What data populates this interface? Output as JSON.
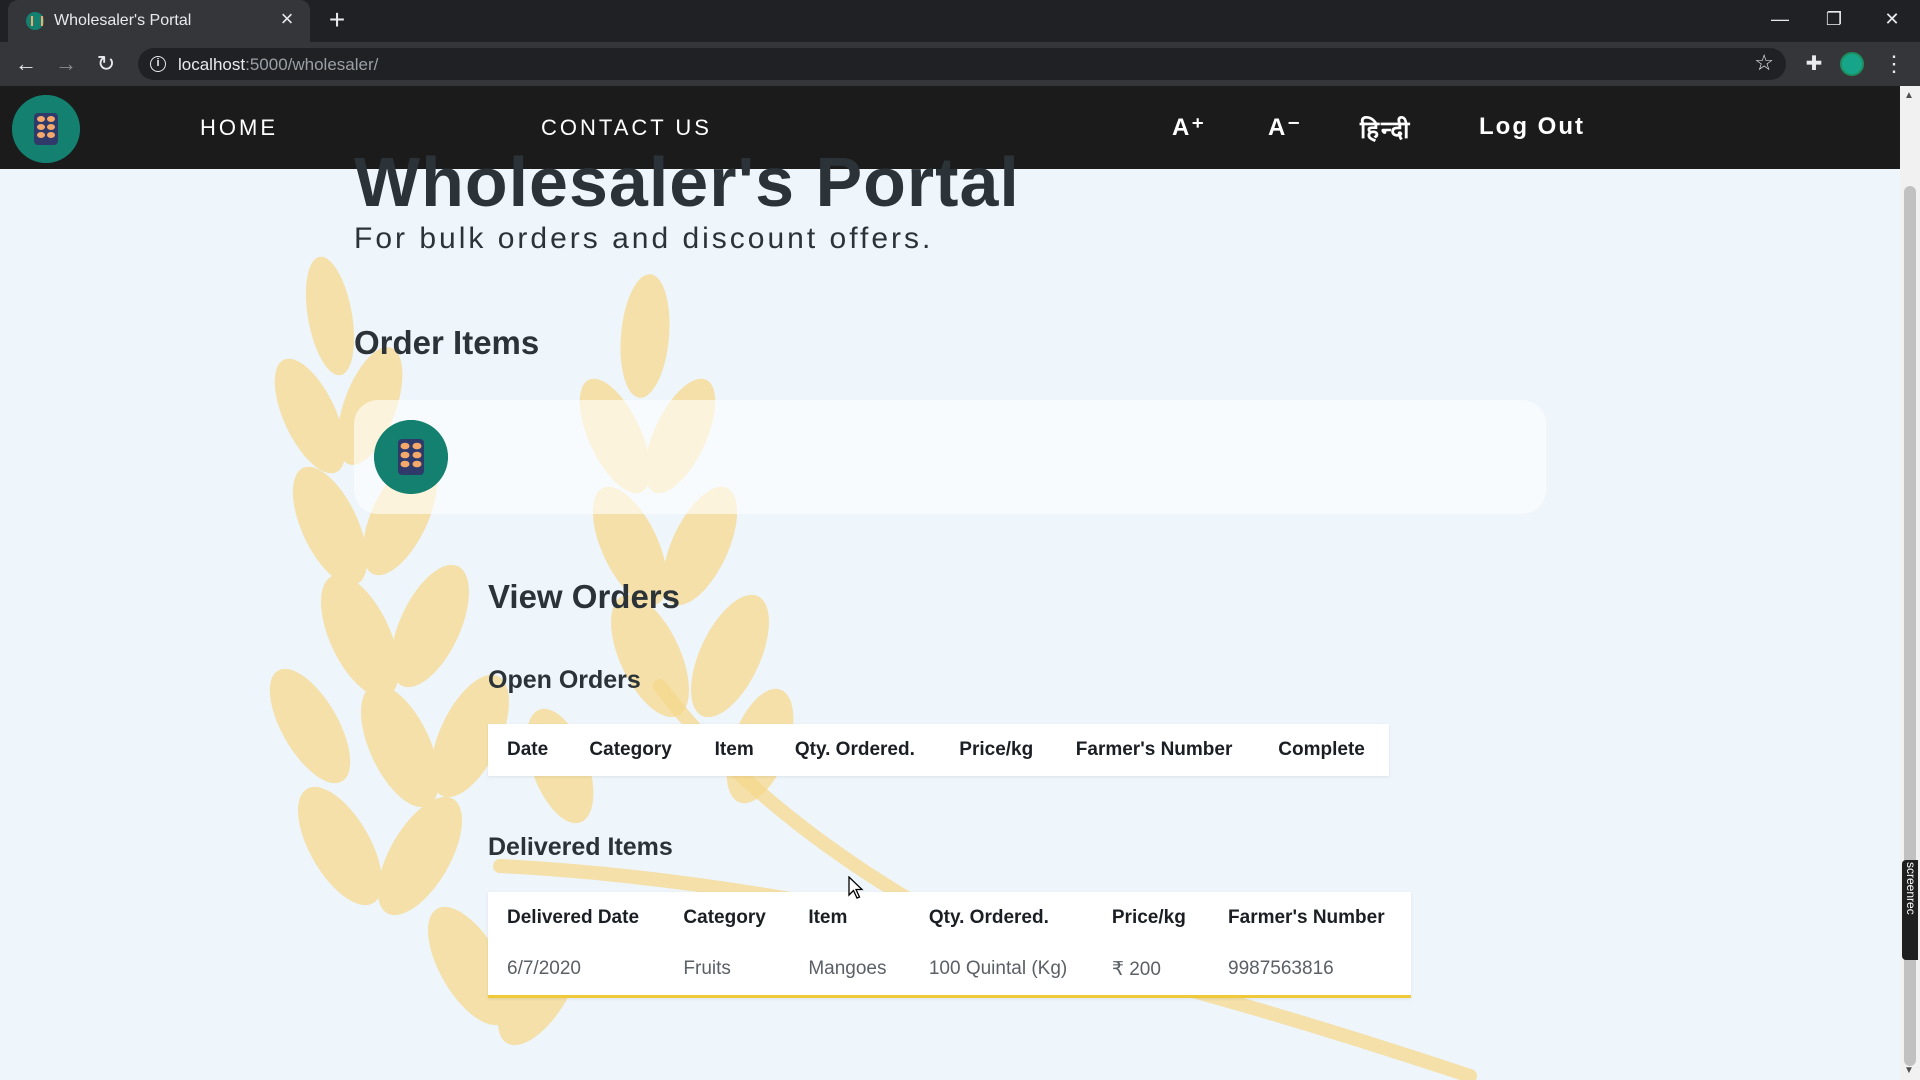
{
  "browser": {
    "tab_title": "Wholesaler's Portal",
    "url_host": "localhost",
    "url_path": ":5000/wholesaler/"
  },
  "nav": {
    "home": "HOME",
    "contact": "CONTACT US",
    "font_increase": "A⁺",
    "font_decrease": "A⁻",
    "language": "हिन्दी",
    "logout": "Log Out"
  },
  "header": {
    "title": "Wholesaler's Portal",
    "subtitle": "For bulk orders and discount offers."
  },
  "order_items": {
    "heading": "Order Items"
  },
  "view_orders": {
    "heading": "View Orders",
    "open_orders": {
      "heading": "Open Orders",
      "columns": [
        "Date",
        "Category",
        "Item",
        "Qty. Ordered.",
        "Price/kg",
        "Farmer's Number",
        "Complete"
      ],
      "rows": []
    },
    "delivered": {
      "heading": "Delivered Items",
      "columns": [
        "Delivered Date",
        "Category",
        "Item",
        "Qty. Ordered.",
        "Price/kg",
        "Farmer's Number"
      ],
      "rows": [
        [
          "6/7/2020",
          "Fruits",
          "Mangoes",
          "100 Quintal (Kg)",
          "₹ 200",
          "9987563816"
        ]
      ]
    }
  },
  "watermark": "screenrec",
  "colors": {
    "nav_bg": "#1b1b1b",
    "logo_bg": "#138070",
    "logo_fg": "#f4a96a",
    "wheat": "#f6d88c",
    "delivered_border": "#f0c93a"
  },
  "icons": [
    "back-icon",
    "forward-icon",
    "reload-icon",
    "info-icon",
    "star-icon",
    "extensions-icon",
    "profile-icon",
    "menu-icon",
    "close-icon",
    "new-tab-icon",
    "wheat-logo-icon"
  ]
}
